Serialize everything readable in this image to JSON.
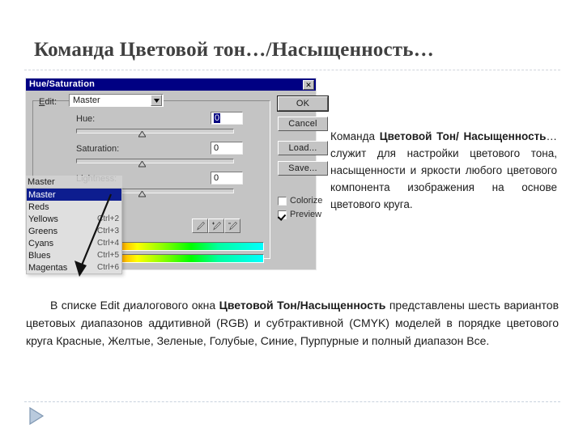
{
  "slide": {
    "title": "Команда Цветовой тон…/Насыщенность…"
  },
  "dialog": {
    "title": "Hue/Saturation",
    "close_icon": "close-icon",
    "edit_label": "Edit:",
    "edit_value": "Master",
    "sliders": [
      {
        "label": "Hue:",
        "value": "0"
      },
      {
        "label": "Saturation:",
        "value": "0"
      },
      {
        "label": "Lightness:",
        "value": "0"
      }
    ],
    "buttons": [
      {
        "label": "OK"
      },
      {
        "label": "Cancel"
      },
      {
        "label": "Load..."
      },
      {
        "label": "Save..."
      }
    ],
    "checkboxes": [
      {
        "label": "Colorize",
        "checked": false
      },
      {
        "label": "Preview",
        "checked": true
      }
    ],
    "eyedroppers": [
      {
        "name": "eyedropper-tool"
      },
      {
        "name": "eyedropper-plus-tool"
      },
      {
        "name": "eyedropper-minus-tool"
      }
    ],
    "dropdown": {
      "preview_item": "Master",
      "items": [
        {
          "label": "Master",
          "shortcut": "",
          "highlight": true
        },
        {
          "label": "Reds",
          "shortcut": "",
          "highlight": false
        },
        {
          "label": "Yellows",
          "shortcut": "Ctrl+2",
          "highlight": false
        },
        {
          "label": "Greens",
          "shortcut": "Ctrl+3",
          "highlight": false
        },
        {
          "label": "Cyans",
          "shortcut": "Ctrl+4",
          "highlight": false
        },
        {
          "label": "Blues",
          "shortcut": "Ctrl+5",
          "highlight": false
        },
        {
          "label": "Magentas",
          "shortcut": "Ctrl+6",
          "highlight": false
        }
      ]
    }
  },
  "side_paragraph": {
    "part1": "Команда ",
    "bold1": "Цветовой Тон/ Насыщенность",
    "part2": "… служит для настройки цветового тона, насыщенности и яркости любого цветового компонента изображения на основе цветового круга."
  },
  "bottom_paragraph": {
    "part1": "В списке Edit диалогового окна ",
    "bold1": "Цветовой Тон/Насыщенность",
    "part2": " представлены шесть вариантов цветовых диапазонов аддитивной (RGB) и субтрактивной (CMYK) моделей в порядке цветового круга Красные, Желтые, Зеленые, Голубые, Синие, Пурпурные и полный диапазон Все."
  },
  "footer": {
    "play_icon": "play-triangle-icon"
  },
  "colors": {
    "titlebar": "#000083",
    "dialog_bg": "#c4c4c4",
    "highlight": "#0d1d8f",
    "heading": "#404040"
  }
}
